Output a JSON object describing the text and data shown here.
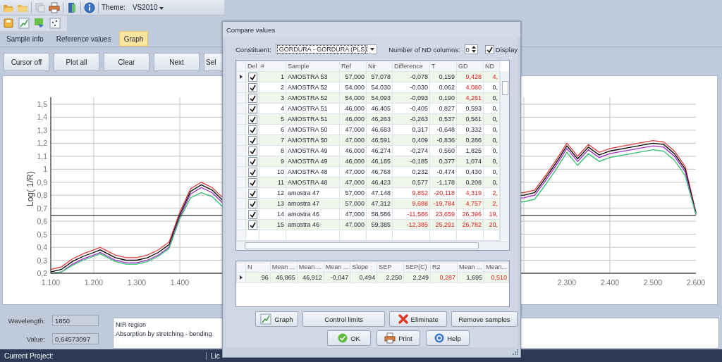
{
  "toolbar": {
    "theme_label": "Theme:",
    "theme_value": "VS2010"
  },
  "tabs": [
    {
      "label": "Sample info",
      "selected": false
    },
    {
      "label": "Reference values",
      "selected": false
    },
    {
      "label": "Graph",
      "selected": true
    }
  ],
  "buttons": [
    "Cursor off",
    "Plot all",
    "Clear",
    "Next",
    "Sel"
  ],
  "chart": {
    "chart_data": {
      "type": "line",
      "ylabel": "Log( 1/R)",
      "xlim": [
        1100,
        2600
      ],
      "ylim": [
        0.2,
        1.5
      ],
      "grid": true,
      "ref_lines": [
        {
          "axis": "y",
          "value": 0.645
        }
      ],
      "xticks": [
        {
          "value": 1100,
          "label": "1.100"
        },
        {
          "value": 1200,
          "label": "1.200"
        },
        {
          "value": 1300,
          "label": "1.300"
        },
        {
          "value": 1400,
          "label": "1.400"
        },
        {
          "value": 2300,
          "label": "2.300"
        },
        {
          "value": 2400,
          "label": "2.400"
        },
        {
          "value": 2500,
          "label": "2.500"
        },
        {
          "value": 2600,
          "label": "2.600"
        }
      ],
      "yticks": [
        {
          "value": 0.2,
          "label": "0,2"
        },
        {
          "value": 0.3,
          "label": "0,3"
        },
        {
          "value": 0.4,
          "label": "0,4"
        },
        {
          "value": 0.5,
          "label": "0,5"
        },
        {
          "value": 0.6,
          "label": "0,6"
        },
        {
          "value": 0.7,
          "label": "0,7"
        },
        {
          "value": 0.8,
          "label": "0,8"
        },
        {
          "value": 0.9,
          "label": "0,9"
        },
        {
          "value": 1,
          "label": "1"
        },
        {
          "value": 1.1,
          "label": "1,1"
        },
        {
          "value": 1.2,
          "label": "1,2"
        },
        {
          "value": 1.3,
          "label": "1,3"
        },
        {
          "value": 1.4,
          "label": "1,4"
        },
        {
          "value": 1.5,
          "label": "1,5"
        }
      ],
      "x": [
        1100,
        1125,
        1150,
        1175,
        1200,
        1215,
        1250,
        1275,
        1300,
        1325,
        1350,
        1375,
        1400,
        1425,
        1450,
        1475,
        1500,
        2200,
        2225,
        2250,
        2275,
        2300,
        2325,
        2350,
        2375,
        2400,
        2450,
        2500,
        2525,
        2550,
        2575,
        2600
      ],
      "series": [
        {
          "color": "#e03c3c",
          "values": [
            0.23,
            0.25,
            0.31,
            0.35,
            0.38,
            0.4,
            0.34,
            0.32,
            0.32,
            0.34,
            0.38,
            0.44,
            0.67,
            0.85,
            0.9,
            0.86,
            0.78,
            0.82,
            0.84,
            0.95,
            1.07,
            1.2,
            1.1,
            1.19,
            1.13,
            1.16,
            1.19,
            1.22,
            1.21,
            1.14,
            1.02,
            0.67
          ]
        },
        {
          "color": "#000000",
          "values": [
            0.21,
            0.23,
            0.29,
            0.33,
            0.36,
            0.38,
            0.32,
            0.3,
            0.3,
            0.32,
            0.36,
            0.42,
            0.65,
            0.83,
            0.88,
            0.84,
            0.76,
            0.8,
            0.82,
            0.93,
            1.05,
            1.18,
            1.08,
            1.17,
            1.11,
            1.14,
            1.17,
            1.2,
            1.19,
            1.12,
            1.0,
            0.66
          ]
        },
        {
          "color": "#9b30c8",
          "values": [
            0.2,
            0.21,
            0.27,
            0.31,
            0.34,
            0.36,
            0.3,
            0.28,
            0.28,
            0.3,
            0.34,
            0.4,
            0.63,
            0.81,
            0.86,
            0.82,
            0.74,
            0.78,
            0.8,
            0.91,
            1.03,
            1.16,
            1.06,
            1.15,
            1.09,
            1.12,
            1.15,
            1.18,
            1.17,
            1.1,
            0.98,
            0.65
          ]
        },
        {
          "color": "#30c070",
          "values": [
            0.2,
            0.21,
            0.26,
            0.3,
            0.33,
            0.35,
            0.29,
            0.27,
            0.27,
            0.29,
            0.33,
            0.39,
            0.62,
            0.78,
            0.82,
            0.79,
            0.71,
            0.75,
            0.77,
            0.88,
            1.0,
            1.13,
            1.03,
            1.12,
            1.06,
            1.09,
            1.12,
            1.15,
            1.14,
            1.07,
            0.95,
            0.65
          ]
        }
      ]
    }
  },
  "wavelength": {
    "label": "Wavelength:",
    "value": "1850"
  },
  "value": {
    "label": "Value:",
    "value": "0,64573097"
  },
  "notes": [
    "NIR region",
    "Absorption by stretching - bending"
  ],
  "status_bar": [
    "Current Project:",
    "Lic"
  ],
  "dialog": {
    "title": "Compare values",
    "constituent_label": "Constituent:",
    "constituent_value": "GORDURA - GORDURA (PLS)",
    "nd_label": "Number of ND columns:",
    "nd_value": "0",
    "display_label": "Display",
    "display_checked": true,
    "table": {
      "checkbox_column": "Del",
      "columns": [
        "#",
        "Sample",
        "Ref",
        "Nir",
        "Difference",
        "T",
        "GD",
        "ND"
      ],
      "rows": [
        {
          "selected": true,
          "checked": true,
          "cells": [
            "1",
            "AMOSTRA 53",
            "57,000",
            "57,078",
            "-0,078",
            "0,159",
            "9,428",
            "4,"
          ],
          "alerts": [
            false,
            false,
            false,
            false,
            false,
            false,
            true,
            true
          ]
        },
        {
          "selected": false,
          "checked": true,
          "cells": [
            "2",
            "AMOSTRA 52",
            "54,000",
            "54,030",
            "-0,030",
            "0,062",
            "4,080",
            "0,"
          ],
          "alerts": [
            false,
            false,
            false,
            false,
            false,
            false,
            true,
            false
          ]
        },
        {
          "selected": false,
          "checked": true,
          "cells": [
            "3",
            "AMOSTRA 52",
            "54,000",
            "54,093",
            "-0,093",
            "0,190",
            "4,261",
            "0,"
          ],
          "alerts": [
            false,
            false,
            false,
            false,
            false,
            false,
            true,
            false
          ]
        },
        {
          "selected": false,
          "checked": true,
          "cells": [
            "4",
            "AMOSTRA 51",
            "46,000",
            "46,405",
            "-0,405",
            "0,827",
            "0,593",
            "0,"
          ],
          "alerts": [
            false,
            false,
            false,
            false,
            false,
            false,
            false,
            false
          ]
        },
        {
          "selected": false,
          "checked": true,
          "cells": [
            "5",
            "AMOSTRA 51",
            "46,000",
            "46,263",
            "-0,263",
            "0,537",
            "0,561",
            "0,"
          ],
          "alerts": [
            false,
            false,
            false,
            false,
            false,
            false,
            false,
            false
          ]
        },
        {
          "selected": false,
          "checked": true,
          "cells": [
            "6",
            "AMOSTRA 50",
            "47,000",
            "46,683",
            "0,317",
            "-0,648",
            "0,332",
            "0,"
          ],
          "alerts": [
            false,
            false,
            false,
            false,
            false,
            false,
            false,
            false
          ]
        },
        {
          "selected": false,
          "checked": true,
          "cells": [
            "7",
            "AMOSTRA 50",
            "47,000",
            "46,591",
            "0,409",
            "-0,836",
            "0,286",
            "0,"
          ],
          "alerts": [
            false,
            false,
            false,
            false,
            false,
            false,
            false,
            false
          ]
        },
        {
          "selected": false,
          "checked": true,
          "cells": [
            "8",
            "AMOSTRA 49",
            "46,000",
            "46,274",
            "-0,274",
            "0,560",
            "1,825",
            "0,"
          ],
          "alerts": [
            false,
            false,
            false,
            false,
            false,
            false,
            false,
            false
          ]
        },
        {
          "selected": false,
          "checked": true,
          "cells": [
            "9",
            "AMOSTRA 49",
            "46,000",
            "46,185",
            "-0,185",
            "0,377",
            "1,074",
            "0,"
          ],
          "alerts": [
            false,
            false,
            false,
            false,
            false,
            false,
            false,
            false
          ]
        },
        {
          "selected": false,
          "checked": true,
          "cells": [
            "10",
            "AMOSTRA 48",
            "47,000",
            "46,768",
            "0,232",
            "-0,474",
            "0,430",
            "0,"
          ],
          "alerts": [
            false,
            false,
            false,
            false,
            false,
            false,
            false,
            false
          ]
        },
        {
          "selected": false,
          "checked": true,
          "cells": [
            "11",
            "AMOSTRA 48",
            "47,000",
            "46,423",
            "0,577",
            "-1,178",
            "0,208",
            "0,"
          ],
          "alerts": [
            false,
            false,
            false,
            false,
            false,
            false,
            false,
            false
          ]
        },
        {
          "selected": false,
          "checked": true,
          "cells": [
            "12",
            "amostra 47",
            "57,000",
            "47,148",
            "9,852",
            "-20,118",
            "4,319",
            "2,"
          ],
          "alerts": [
            false,
            false,
            false,
            false,
            true,
            true,
            true,
            true
          ]
        },
        {
          "selected": false,
          "checked": true,
          "cells": [
            "13",
            "amostra 47",
            "57,000",
            "47,312",
            "9,688",
            "-19,784",
            "4,757",
            "2,"
          ],
          "alerts": [
            false,
            false,
            false,
            false,
            true,
            true,
            true,
            true
          ]
        },
        {
          "selected": false,
          "checked": true,
          "cells": [
            "14",
            "amostra 46",
            "47,000",
            "58,586",
            "-11,586",
            "23,659",
            "26,396",
            "19,"
          ],
          "alerts": [
            false,
            false,
            false,
            false,
            true,
            true,
            true,
            true
          ]
        },
        {
          "selected": false,
          "checked": true,
          "cells": [
            "15",
            "amostra 46",
            "47,000",
            "59,385",
            "-12,385",
            "25,291",
            "26,782",
            "20,"
          ],
          "alerts": [
            false,
            false,
            false,
            false,
            true,
            true,
            true,
            true
          ]
        }
      ]
    },
    "summary": {
      "columns": [
        "N",
        "Mean ...",
        "Mean ...",
        "Mean ...",
        "Slope",
        "SEP",
        "SEP(C)",
        "R2",
        "Mean ...",
        "Mean..."
      ],
      "rows": [
        {
          "selected": true,
          "cells": [
            "96",
            "46,865",
            "46,912",
            "-0,047",
            "0,494",
            "2,250",
            "2,249",
            "0,287",
            "1,695",
            "0,510"
          ],
          "alerts": [
            false,
            false,
            false,
            false,
            false,
            false,
            false,
            true,
            false,
            true
          ]
        }
      ]
    },
    "action_buttons": [
      "Graph",
      "Control limits",
      "Eliminate",
      "Remove samples"
    ],
    "footer_buttons": [
      "OK",
      "Print",
      "Help"
    ]
  }
}
